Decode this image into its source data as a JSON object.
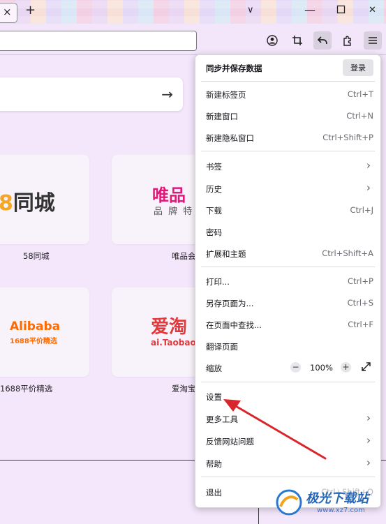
{
  "titlebar": {
    "tab_close_glyph": "×",
    "newtab_glyph": "+",
    "minimize_glyph": "∨",
    "restore_glyph": "□",
    "close_glyph": "✕"
  },
  "toolbar": {
    "icons": [
      "account-icon",
      "screenshot-crop-icon",
      "back-arrow-icon",
      "extensions-icon",
      "hamburger-menu-icon"
    ]
  },
  "newtab": {
    "search_arrow": "→",
    "tiles": [
      {
        "label": "58同城",
        "logo_text": "8同城",
        "logo_color": "#333333",
        "accent": "#f5a623"
      },
      {
        "label": "唯品会",
        "logo_text": "唯品",
        "logo_sub": "品 牌 特",
        "logo_color": "#e0187a"
      },
      {
        "label": "1688平价精选",
        "logo_text": "Alibaba",
        "logo_sub": "1688平价精选",
        "logo_color": "#ff6a00"
      },
      {
        "label": "爱淘宝",
        "logo_text": "爱淘",
        "logo_sub": "ai.Taobao",
        "logo_color": "#e4393c"
      }
    ]
  },
  "menu": {
    "header_title": "同步并保存数据",
    "login_label": "登录",
    "items": [
      {
        "label": "新建标签页",
        "shortcut": "Ctrl+T"
      },
      {
        "label": "新建窗口",
        "shortcut": "Ctrl+N"
      },
      {
        "label": "新建隐私窗口",
        "shortcut": "Ctrl+Shift+P"
      },
      {
        "label": "书签",
        "shortcut": ""
      },
      {
        "label": "历史",
        "shortcut": ""
      },
      {
        "label": "下载",
        "shortcut": "Ctrl+J"
      },
      {
        "label": "密码",
        "shortcut": ""
      },
      {
        "label": "扩展和主题",
        "shortcut": "Ctrl+Shift+A"
      },
      {
        "label": "打印...",
        "shortcut": "Ctrl+P"
      },
      {
        "label": "另存页面为...",
        "shortcut": "Ctrl+S"
      },
      {
        "label": "在页面中查找...",
        "shortcut": "Ctrl+F"
      },
      {
        "label": "翻译页面",
        "shortcut": ""
      },
      {
        "label": "缩放",
        "shortcut": ""
      },
      {
        "label": "设置",
        "shortcut": ""
      },
      {
        "label": "更多工具",
        "shortcut": ""
      },
      {
        "label": "反馈网站问题",
        "shortcut": ""
      },
      {
        "label": "帮助",
        "shortcut": ""
      },
      {
        "label": "退出",
        "shortcut": "Ctrl+Shift+Q"
      }
    ],
    "zoom": {
      "minus": "−",
      "value": "100%",
      "plus": "+"
    },
    "submenu_arrow": "›"
  },
  "watermark": {
    "text": "极光下载站",
    "url": "www.xz7.com"
  },
  "colors": {
    "annotation_arrow": "#d9262c",
    "menu_bg": "#ffffff",
    "page_bg": "#f4e6fb"
  }
}
